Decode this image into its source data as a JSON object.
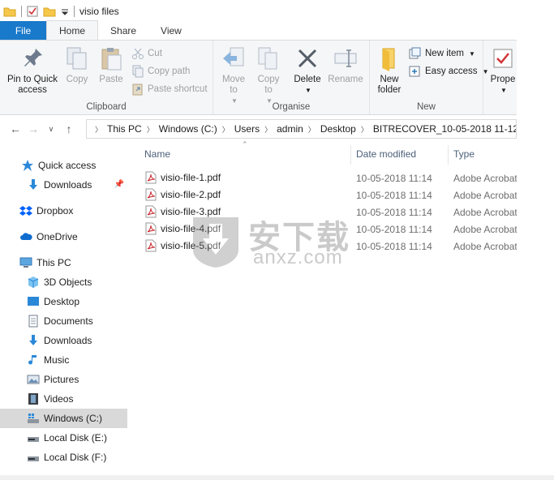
{
  "window": {
    "title": "visio files"
  },
  "tabs": [
    {
      "label": "File"
    },
    {
      "label": "Home"
    },
    {
      "label": "Share"
    },
    {
      "label": "View"
    }
  ],
  "ribbon": {
    "clipboard": {
      "label": "Clipboard",
      "pin_to_quick_access": "Pin to Quick access",
      "copy": "Copy",
      "paste": "Paste",
      "cut": "Cut",
      "copy_path": "Copy path",
      "paste_shortcut": "Paste shortcut"
    },
    "organise": {
      "label": "Organise",
      "move_to": "Move to",
      "copy_to": "Copy to",
      "delete": "Delete",
      "rename": "Rename"
    },
    "new": {
      "label": "New",
      "new_folder": "New folder",
      "new_item": "New item",
      "easy_access": "Easy access"
    },
    "open": {
      "properties": "Prope"
    }
  },
  "address": {
    "crumbs": [
      "This PC",
      "Windows (C:)",
      "Users",
      "admin",
      "Desktop",
      "BITRECOVER_10-05-2018 11-12"
    ]
  },
  "nav": {
    "quick_access": "Quick access",
    "qa_downloads": "Downloads",
    "dropbox": "Dropbox",
    "onedrive": "OneDrive",
    "this_pc": "This PC",
    "objects3d": "3D Objects",
    "desktop": "Desktop",
    "documents": "Documents",
    "downloads": "Downloads",
    "music": "Music",
    "pictures": "Pictures",
    "videos": "Videos",
    "windows_c": "Windows (C:)",
    "local_e": "Local Disk (E:)",
    "local_f": "Local Disk (F:)"
  },
  "columns": {
    "name": "Name",
    "date": "Date modified",
    "type": "Type"
  },
  "files": [
    {
      "name": "visio-file-1.pdf",
      "date": "10-05-2018 11:14",
      "type": "Adobe Acrobat"
    },
    {
      "name": "visio-file-2.pdf",
      "date": "10-05-2018 11:14",
      "type": "Adobe Acrobat"
    },
    {
      "name": "visio-file-3.pdf",
      "date": "10-05-2018 11:14",
      "type": "Adobe Acrobat"
    },
    {
      "name": "visio-file-4.pdf",
      "date": "10-05-2018 11:14",
      "type": "Adobe Acrobat"
    },
    {
      "name": "visio-file-5.pdf",
      "date": "10-05-2018 11:14",
      "type": "Adobe Acrobat"
    }
  ],
  "watermark": {
    "cn": "安下载",
    "en": "anxz.com"
  },
  "colors": {
    "accent": "#1979ca",
    "selected": "#d9d9d9",
    "header_text": "#4c607a"
  }
}
